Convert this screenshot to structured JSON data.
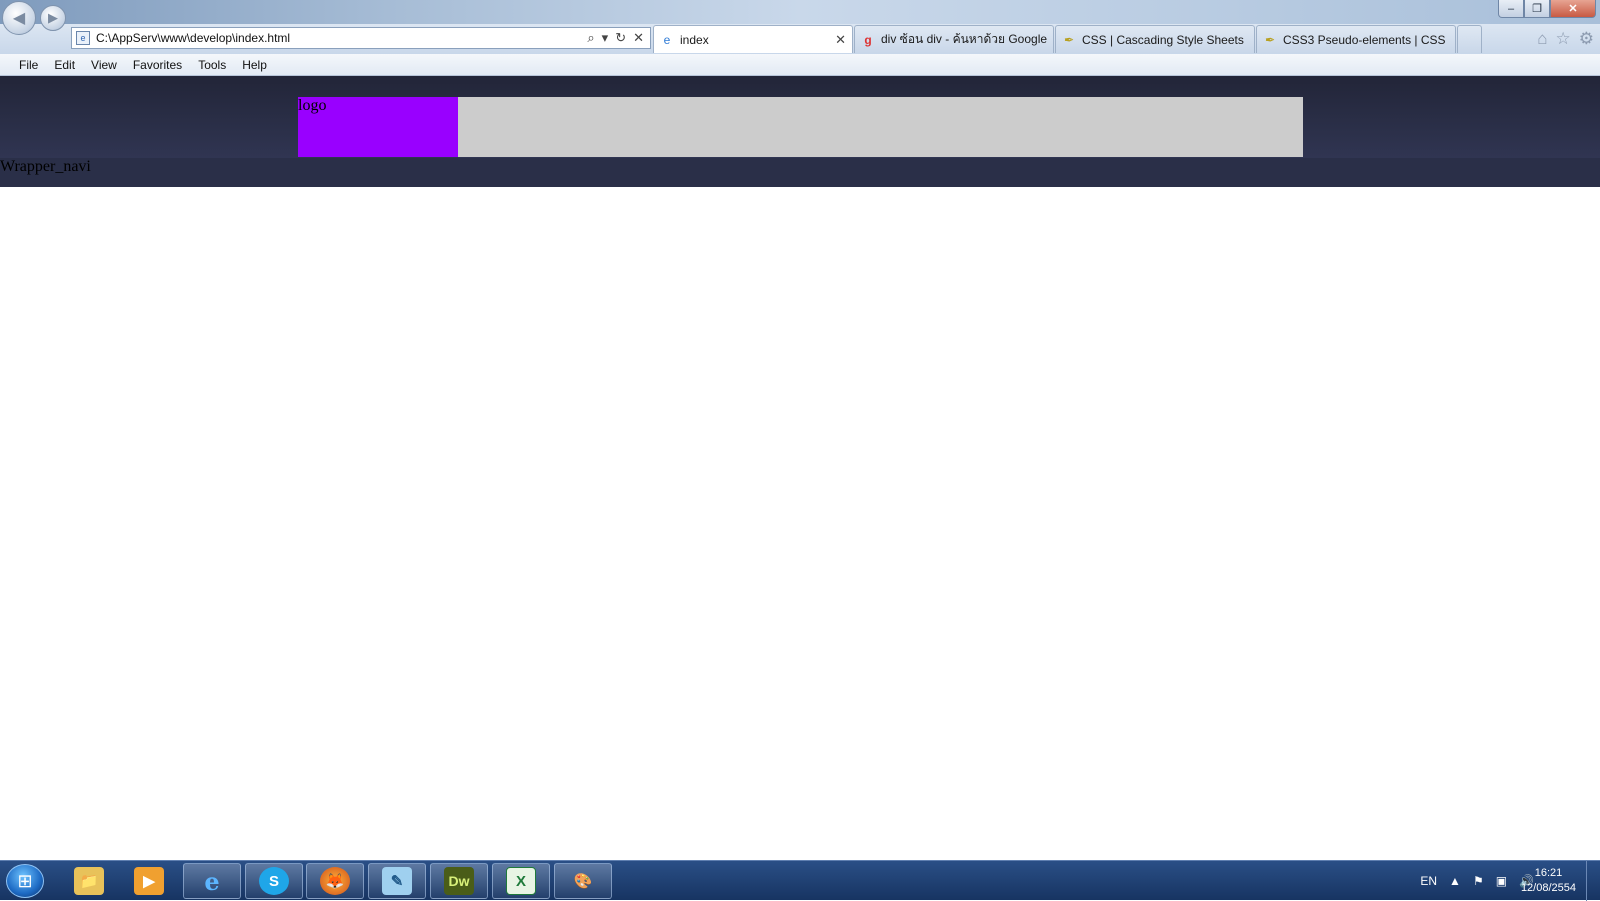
{
  "window": {
    "controls": {
      "minimize": "–",
      "restore": "❐",
      "close": "✕"
    }
  },
  "browser": {
    "address": "C:\\AppServ\\www\\develop\\index.html",
    "tabs": [
      {
        "label": "index",
        "icon": "ie-icon",
        "active": true
      },
      {
        "label": "div ซ้อน div - ค้นหาด้วย Google",
        "icon": "google-icon",
        "active": false
      },
      {
        "label": "CSS | Cascading Style Sheets | ...",
        "icon": "feather-icon",
        "active": false
      },
      {
        "label": "CSS3 Pseudo-elements | CSS C...",
        "icon": "feather-icon",
        "active": false
      }
    ],
    "tab_close": "✕",
    "menu": [
      "File",
      "Edit",
      "View",
      "Favorites",
      "Tools",
      "Help"
    ]
  },
  "page": {
    "logo_text": "logo",
    "nav_text": "Wrapper_navi",
    "colors": {
      "logo_bg": "#9900ff",
      "header_gray": "#cccccc",
      "band": "#2a2f48"
    }
  },
  "taskbar": {
    "apps": [
      {
        "name": "windows-explorer",
        "glyph": "📁"
      },
      {
        "name": "media-player",
        "glyph": "▶"
      },
      {
        "name": "internet-explorer",
        "glyph": "e"
      },
      {
        "name": "skype",
        "glyph": "S"
      },
      {
        "name": "firefox",
        "glyph": "🦊"
      },
      {
        "name": "notepad-app",
        "glyph": "✎"
      },
      {
        "name": "dreamweaver",
        "glyph": "Dw"
      },
      {
        "name": "excel",
        "glyph": "X"
      },
      {
        "name": "paint",
        "glyph": "🎨"
      }
    ],
    "language": "EN",
    "time": "16:21",
    "date": "12/08/2554"
  }
}
